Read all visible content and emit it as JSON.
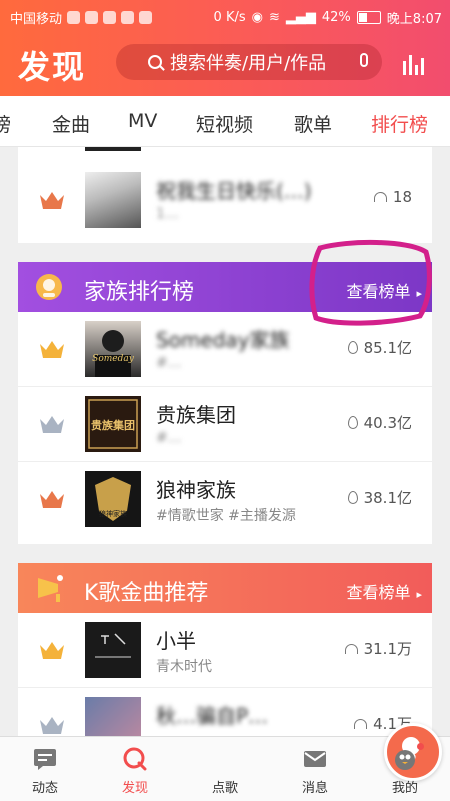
{
  "status": {
    "carrier": "中国移动",
    "network": "0 K/s",
    "battery": "42%",
    "time": "晚上8:07"
  },
  "header": {
    "title": "发现",
    "search_placeholder": "搜索伴奏/用户/作品"
  },
  "tabs": [
    {
      "label": "榜",
      "active": false
    },
    {
      "label": "金曲",
      "active": false
    },
    {
      "label": "MV",
      "active": false
    },
    {
      "label": "短视频",
      "active": false
    },
    {
      "label": "歌单",
      "active": false
    },
    {
      "label": "排行榜",
      "active": true
    }
  ],
  "top_list": {
    "rows": [
      {
        "rank": 3,
        "title": "祝我生日快乐(…)",
        "sub": "1…",
        "value": "18",
        "value_icon": "headphones-icon"
      }
    ]
  },
  "family_rank": {
    "title": "家族排行榜",
    "more": "查看榜单",
    "rows": [
      {
        "rank": 1,
        "thumb_text": "Someday",
        "title": "Someday家族",
        "sub": "#…",
        "value": "85.1亿",
        "value_icon": "fire-icon"
      },
      {
        "rank": 2,
        "thumb_text": "贵族集团",
        "title": "贵族集团",
        "sub": "#…",
        "value": "40.3亿",
        "value_icon": "fire-icon"
      },
      {
        "rank": 3,
        "thumb_text": "狼神家族",
        "title": "狼神家族",
        "sub": "#情歌世家 #主播发源",
        "value": "38.1亿",
        "value_icon": "fire-icon"
      }
    ]
  },
  "kge_rank": {
    "title": "K歌金曲推荐",
    "more": "查看榜单",
    "rows": [
      {
        "rank": 1,
        "title": "小半",
        "sub": "青木时代",
        "value": "31.1万",
        "value_icon": "headphones-icon"
      },
      {
        "rank": 2,
        "title": "秋…骗自P…",
        "sub": "",
        "value": "4.1万",
        "value_icon": "headphones-icon"
      }
    ]
  },
  "bottom_nav": [
    {
      "label": "动态",
      "icon": "chat-icon",
      "active": false
    },
    {
      "label": "发现",
      "icon": "discover-icon",
      "active": true
    },
    {
      "label": "点歌",
      "icon": "mic-icon",
      "active": false
    },
    {
      "label": "消息",
      "icon": "mail-icon",
      "active": false
    },
    {
      "label": "我的",
      "icon": "penguin-icon",
      "active": false
    }
  ],
  "colors": {
    "brand": "#f24d4d",
    "family_header": "#8e3fd0",
    "kge_header": "#f2665a",
    "crown_gold": "#f4b23a",
    "crown_silver": "#a9b3c2",
    "crown_bronze": "#e8774a"
  }
}
